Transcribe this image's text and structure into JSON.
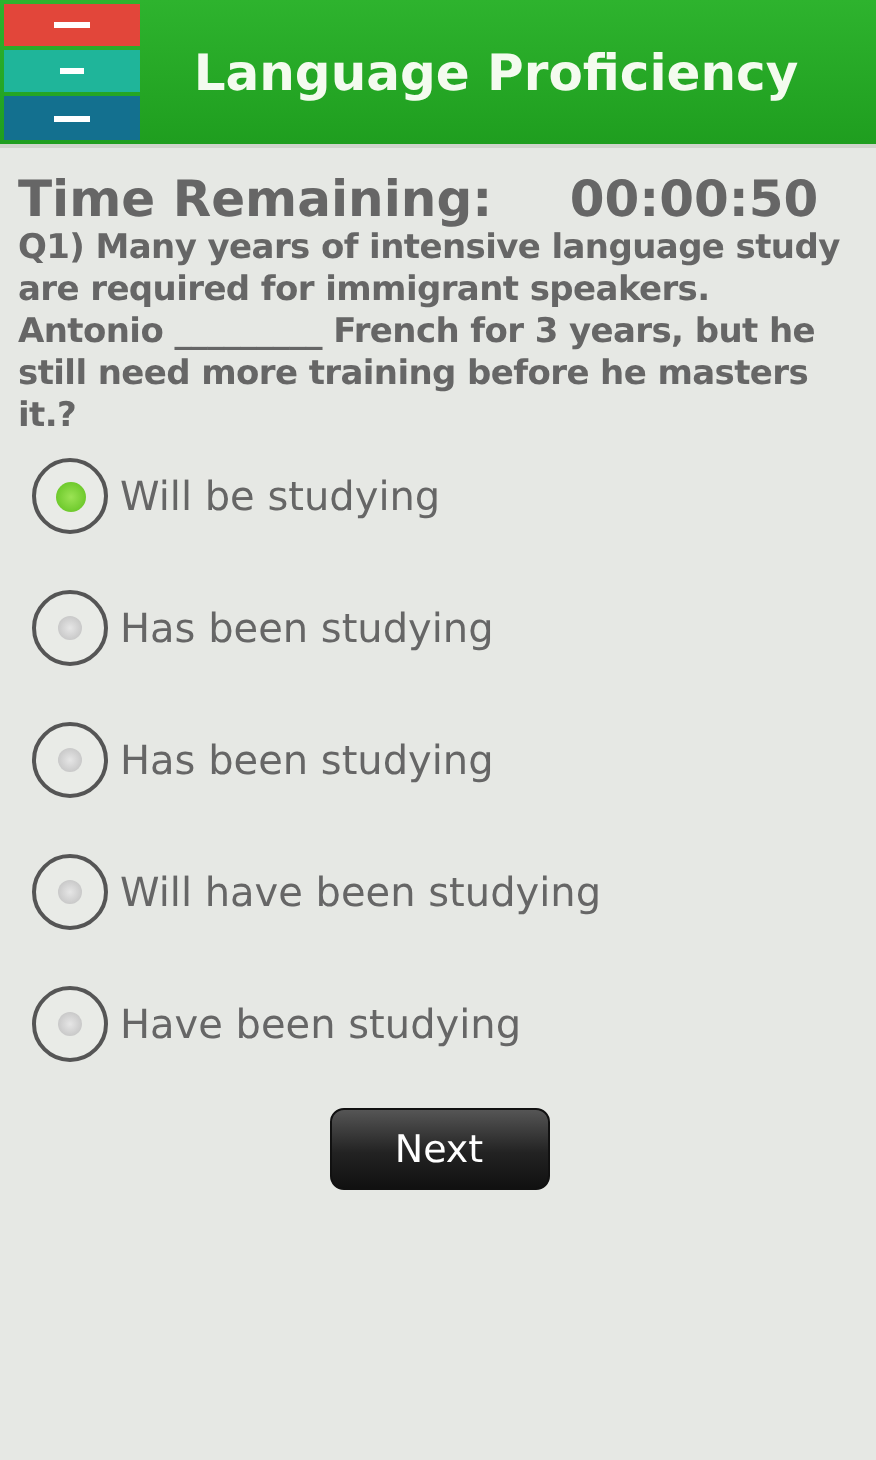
{
  "header": {
    "title": "Language Proficiency"
  },
  "timer": {
    "label": "Time Remaining:",
    "value": "00:00:50"
  },
  "question": "Q1) Many years of intensive language study are required for immigrant speakers. Antonio _________ French for 3 years, but he still need more training before he masters it.?",
  "options": [
    {
      "label": "Will be studying",
      "selected": true
    },
    {
      "label": "Has been studying",
      "selected": false
    },
    {
      "label": "Has been studying",
      "selected": false
    },
    {
      "label": "Will have been studying",
      "selected": false
    },
    {
      "label": "Have been studying",
      "selected": false
    }
  ],
  "buttons": [
    "Next"
  ]
}
